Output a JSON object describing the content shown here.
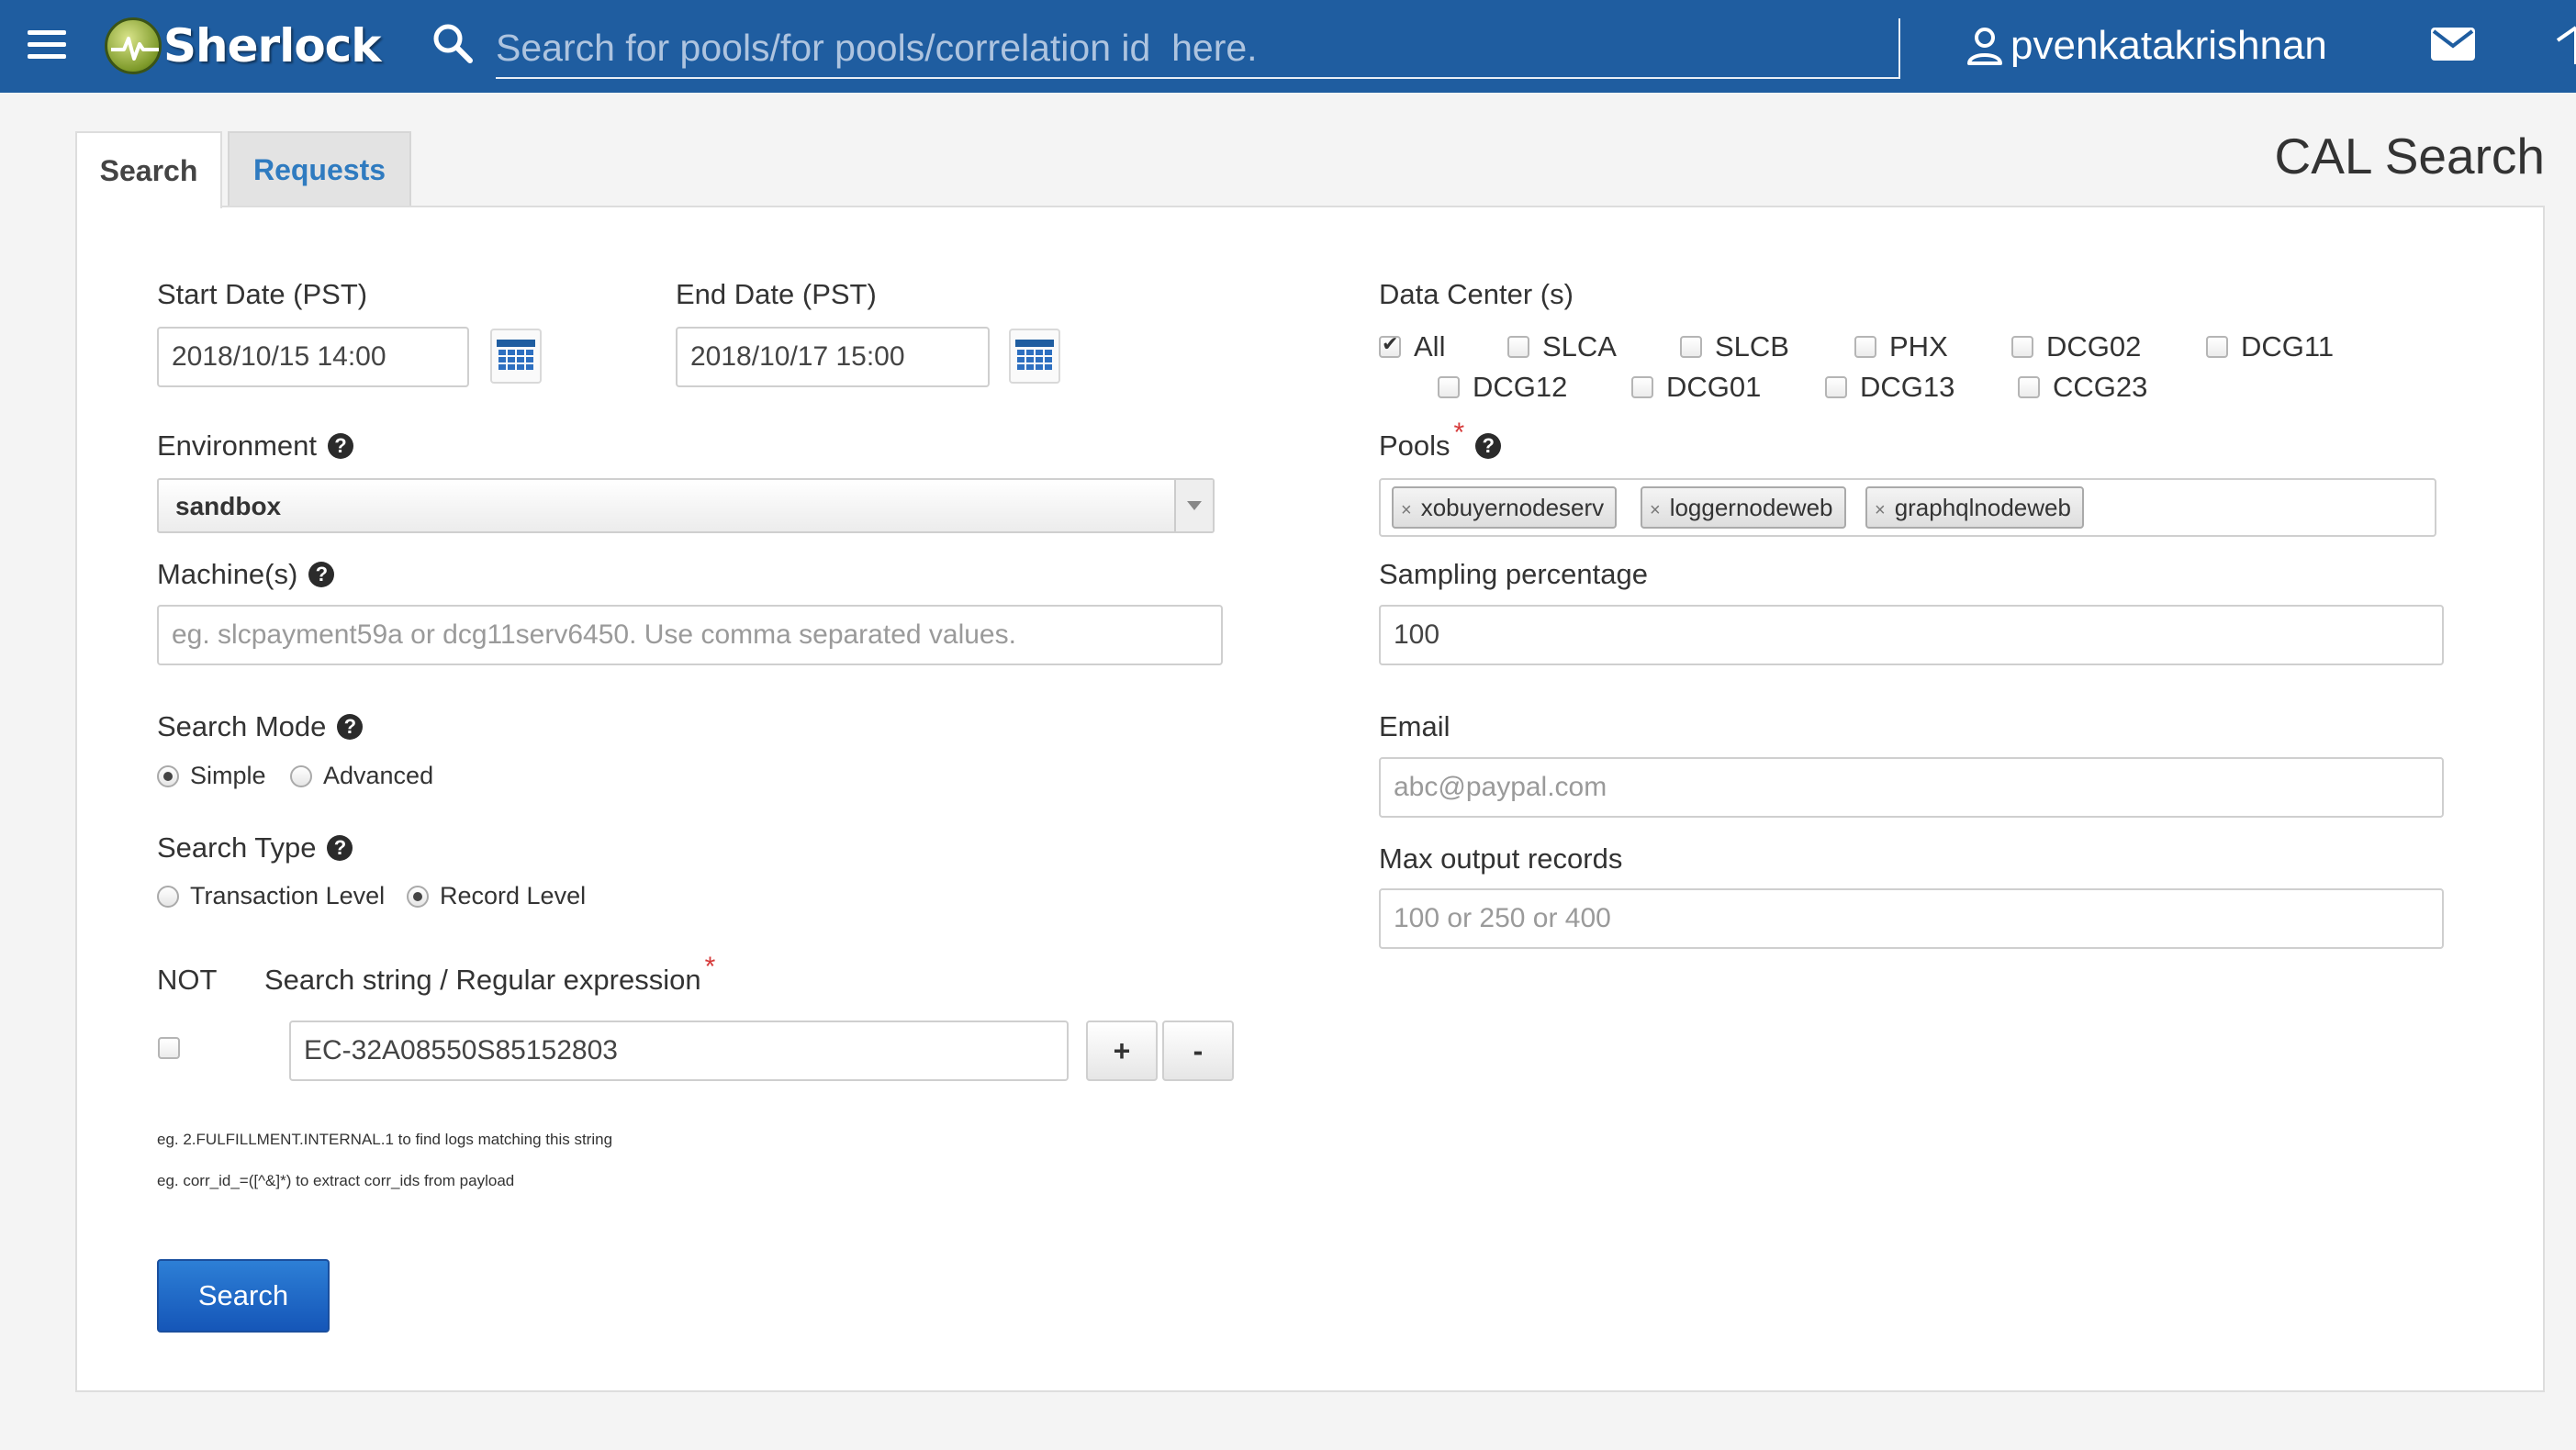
{
  "header": {
    "app_name": "Sherlock",
    "search_placeholder": "Search for pools/for pools/correlation id  here.",
    "username": "pvenkatakrishnan"
  },
  "tabs": [
    {
      "label": "Search",
      "active": true
    },
    {
      "label": "Requests",
      "active": false
    }
  ],
  "page_title": "CAL Search",
  "form": {
    "start_date": {
      "label": "Start Date (PST)",
      "value": "2018/10/15 14:00"
    },
    "end_date": {
      "label": "End Date (PST)",
      "value": "2018/10/17 15:00"
    },
    "environment": {
      "label": "Environment",
      "value": "sandbox"
    },
    "machines": {
      "label": "Machine(s)",
      "placeholder": "eg. slcpayment59a or dcg11serv6450. Use comma separated values."
    },
    "search_mode": {
      "label": "Search Mode",
      "options": [
        "Simple",
        "Advanced"
      ],
      "selected": "Simple"
    },
    "search_type": {
      "label": "Search Type",
      "options": [
        "Transaction Level",
        "Record Level"
      ],
      "selected": "Record Level"
    },
    "not_label": "NOT",
    "search_string": {
      "label": "Search string / Regular expression",
      "value": "EC-32A08550S85152803",
      "required_mark": "*"
    },
    "add_button": "+",
    "remove_button": "-",
    "hints": [
      "eg. 2.FULFILLMENT.INTERNAL.1 to find logs matching this string",
      "eg. corr_id_=([^&]*) to extract corr_ids from payload"
    ],
    "submit_label": "Search"
  },
  "right": {
    "data_centers": {
      "label": "Data Center (s)",
      "items": [
        {
          "name": "All",
          "checked": true
        },
        {
          "name": "SLCA",
          "checked": false
        },
        {
          "name": "SLCB",
          "checked": false
        },
        {
          "name": "PHX",
          "checked": false
        },
        {
          "name": "DCG02",
          "checked": false
        },
        {
          "name": "DCG11",
          "checked": false
        },
        {
          "name": "DCG12",
          "checked": false
        },
        {
          "name": "DCG01",
          "checked": false
        },
        {
          "name": "DCG13",
          "checked": false
        },
        {
          "name": "CCG23",
          "checked": false
        }
      ]
    },
    "pools": {
      "label": "Pools",
      "required_mark": "*",
      "tags": [
        "xobuyernodeserv",
        "loggernodeweb",
        "graphqlnodeweb"
      ],
      "remove_glyph": "×"
    },
    "sampling": {
      "label": "Sampling percentage",
      "value": "100"
    },
    "email": {
      "label": "Email",
      "placeholder": "abc@paypal.com"
    },
    "max_records": {
      "label": "Max output records",
      "placeholder": "100 or 250 or 400"
    }
  },
  "icons": {
    "help_glyph": "?"
  },
  "colors": {
    "header_bg": "#1f5da0",
    "link": "#2f7bc0",
    "primary_button": "#1f6cc8",
    "required": "#d63a3a"
  }
}
